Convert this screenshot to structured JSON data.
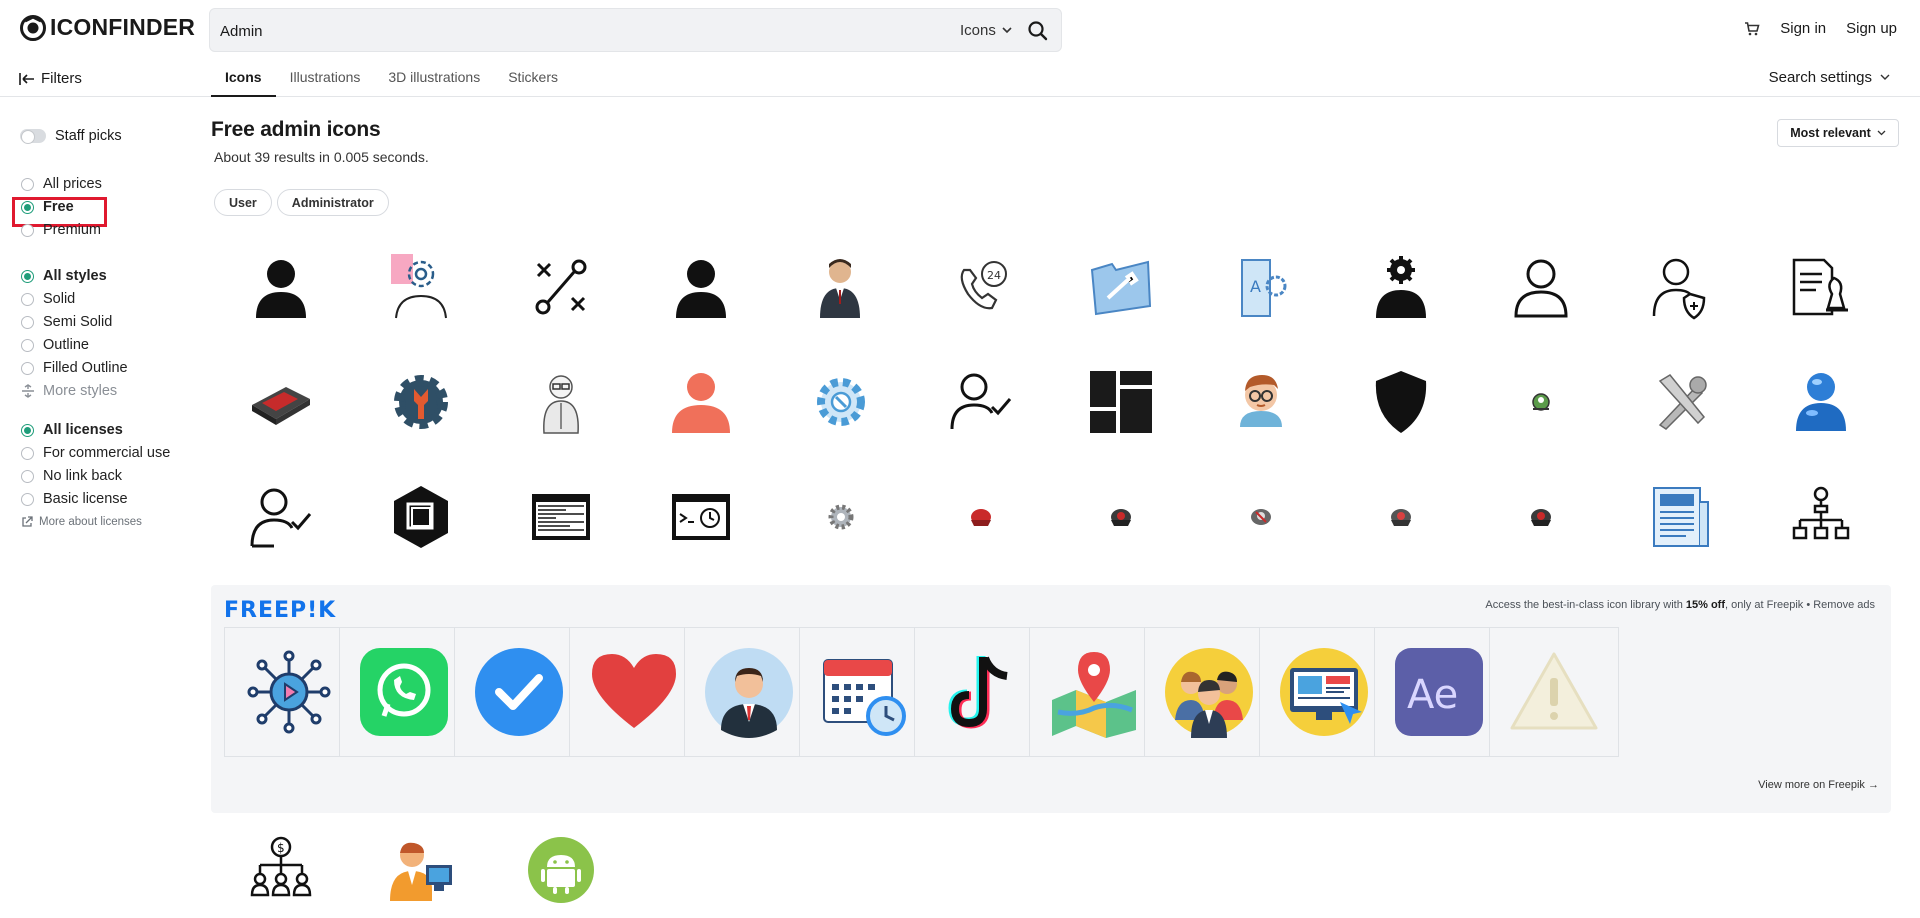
{
  "header": {
    "logo_text": "ICONFINDER",
    "search_value": "Admin",
    "search_type": "Icons",
    "sign_in": "Sign in",
    "sign_up": "Sign up"
  },
  "subnav": {
    "filters_label": "Filters",
    "tabs": [
      {
        "label": "Icons",
        "active": true
      },
      {
        "label": "Illustrations",
        "active": false
      },
      {
        "label": "3D illustrations",
        "active": false
      },
      {
        "label": "Stickers",
        "active": false
      }
    ],
    "search_settings": "Search settings"
  },
  "sidebar": {
    "staff_picks": "Staff picks",
    "prices": [
      "All prices",
      "Free",
      "Premium"
    ],
    "selected_price": "Free",
    "styles": [
      "All styles",
      "Solid",
      "Semi Solid",
      "Outline",
      "Filled Outline"
    ],
    "selected_style": "All styles",
    "more_styles": "More styles",
    "licenses": [
      "All licenses",
      "For commercial use",
      "No link back",
      "Basic license"
    ],
    "selected_license": "All licenses",
    "more_about_licenses": "More about licenses"
  },
  "main": {
    "title": "Free admin icons",
    "results": "About 39 results in 0.005 seconds.",
    "sort": "Most relevant",
    "chips": [
      "User",
      "Administrator"
    ]
  },
  "icons": [
    [
      "user-solid-icon",
      "gear-user-outline-icon",
      "path-tools-icon",
      "user-solid-icon",
      "businessman-icon",
      "phone-24-icon",
      "folder-tools-icon",
      "document-gear-icon",
      "user-gear-solid-icon",
      "user-outline-icon",
      "user-shield-icon",
      "chess-document-icon"
    ],
    [
      "server-drive-icon",
      "gear-wrench-icon",
      "old-man-icon",
      "user-orange-icon",
      "gear-blue-icon",
      "user-check-icon",
      "dashboard-blocks-icon",
      "man-glasses-icon",
      "shield-solid-icon",
      "green-user-small-icon",
      "tools-cross-icon",
      "blue-user-3d-icon"
    ],
    [
      "user-check-outline-icon",
      "hexagon-window-icon",
      "browser-window-icon",
      "terminal-window-icon",
      "gear-small-icon",
      "red-user-small-icon",
      "red-user-small-icon",
      "red-user-small-icon",
      "red-user-small-icon",
      "red-user-small-icon",
      "newspaper-icon",
      "hierarchy-icon"
    ]
  ],
  "freepik": {
    "logo": "FREEP!K",
    "promo_prefix": "Access the best-in-class icon library with ",
    "promo_bold": "15% off",
    "promo_suffix": ", only at Freepik • Remove ads",
    "tiles": [
      "network-play-icon",
      "whatsapp-icon",
      "blue-check-icon",
      "heart-icon",
      "businessman-avatar-icon",
      "calendar-clock-icon",
      "tiktok-icon",
      "map-pin-icon",
      "team-avatar-icon",
      "computer-design-icon",
      "after-effects-icon",
      "warning-icon"
    ],
    "view_more": "View more on Freepik →"
  },
  "bottom_icons": [
    "money-hierarchy-icon",
    "admin-computer-icon",
    "android-icon"
  ],
  "colors": {
    "accent_green": "#1f9d7a",
    "highlight_red": "#e0192f",
    "freepik_blue": "#1273eb"
  }
}
